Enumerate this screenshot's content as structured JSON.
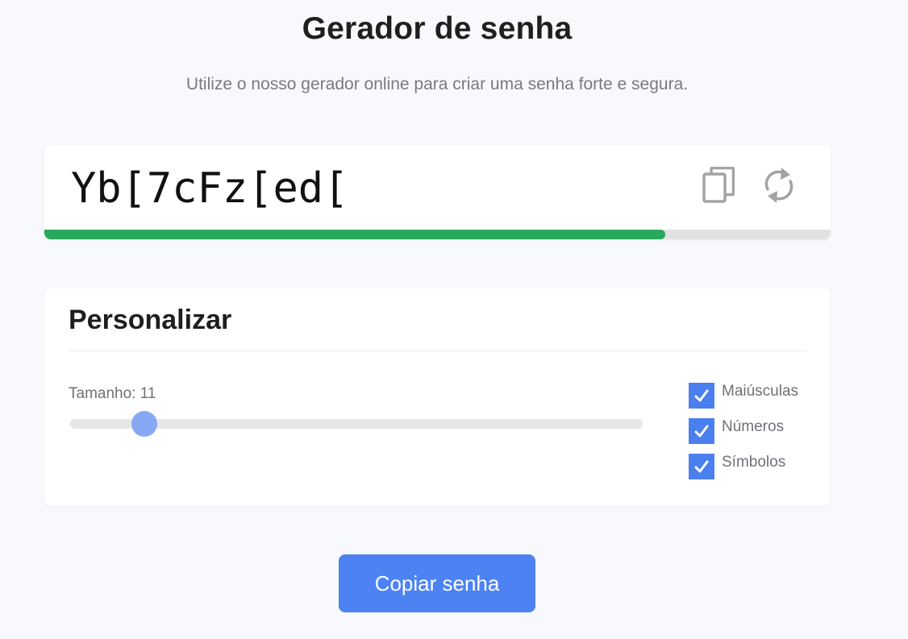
{
  "header": {
    "title": "Gerador de senha",
    "subtitle": "Utilize o nosso gerador online para criar uma senha forte e segura."
  },
  "password": {
    "value": "Yb[7cFz[ed[",
    "copy_icon": "copy-icon",
    "refresh_icon": "refresh-icon",
    "strength_fraction": 0.79,
    "strength_color": "#27a85a"
  },
  "customize": {
    "title": "Personalizar",
    "length_label": "Tamanho: 11",
    "length_value": 11,
    "length_fraction": 0.13,
    "options": [
      {
        "label": "Maiúsculas",
        "checked": true
      },
      {
        "label": "Números",
        "checked": true
      },
      {
        "label": "Símbolos",
        "checked": true
      }
    ]
  },
  "actions": {
    "copy_label": "Copiar senha"
  },
  "colors": {
    "accent": "#4d82f3",
    "checkbox": "#4a7ff0",
    "slider_thumb": "#86a8f5",
    "background": "#f8f9fc"
  }
}
